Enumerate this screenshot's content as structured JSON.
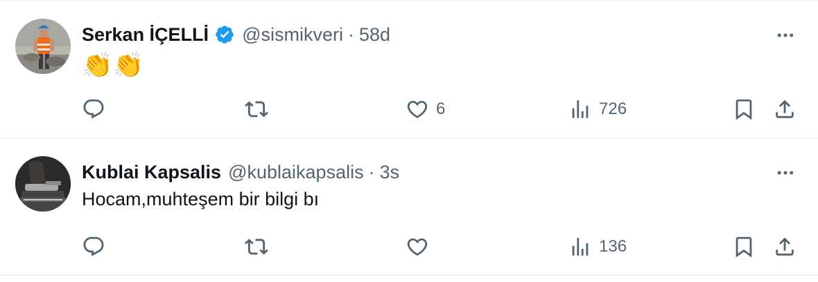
{
  "tweets": [
    {
      "author_name": "Serkan İÇELLİ",
      "verified": true,
      "handle": "@sismikveri",
      "separator": "·",
      "time": "58d",
      "text": "👏👏",
      "reply_count": "",
      "retweet_count": "",
      "like_count": "6",
      "view_count": "726"
    },
    {
      "author_name": "Kublai Kapsalis",
      "verified": false,
      "handle": "@kublaikapsalis",
      "separator": "·",
      "time": "3s",
      "text": "Hocam,muhteşem bir bilgi bı",
      "reply_count": "",
      "retweet_count": "",
      "like_count": "",
      "view_count": "136"
    }
  ],
  "colors": {
    "text_primary": "#0f1419",
    "text_secondary": "#536471",
    "verified_badge": "#1d9bf0",
    "divider": "#eff3f4"
  },
  "icons": [
    "more-icon",
    "reply-icon",
    "retweet-icon",
    "like-icon",
    "views-icon",
    "bookmark-icon",
    "share-icon",
    "verified-badge-icon"
  ]
}
